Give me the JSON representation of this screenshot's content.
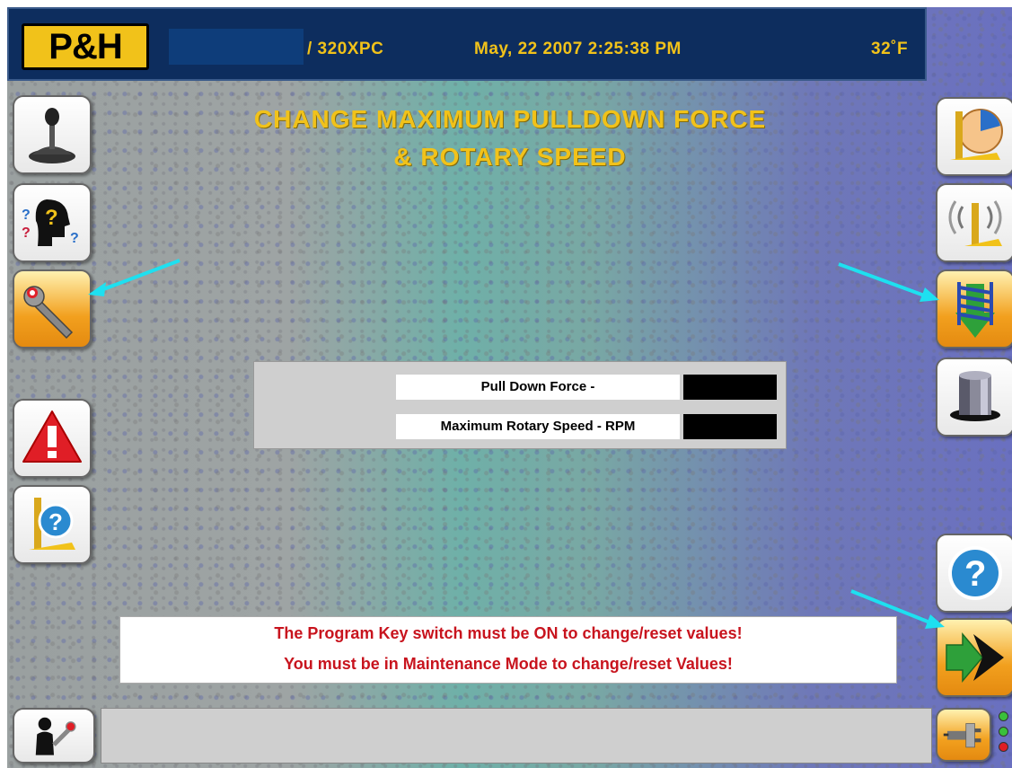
{
  "header": {
    "logo": "P&H",
    "model": "/ 320XPC",
    "datetime": "May, 22 2007 2:25:38 PM",
    "temperature": "32˚F"
  },
  "title": {
    "line1": "CHANGE MAXIMUM PULLDOWN FORCE",
    "line2": "& ROTARY SPEED"
  },
  "form": {
    "fields": [
      {
        "label": "Pull Down Force -",
        "value": ""
      },
      {
        "label": "Maximum Rotary Speed - RPM",
        "value": ""
      }
    ]
  },
  "messages": {
    "line1": "The Program Key switch must be ON to change/reset values!",
    "line2": "You must be in Maintenance Mode to change/reset Values!"
  },
  "status_bar": {
    "text": ""
  },
  "left_buttons": [
    "joystick-icon",
    "help-head-icon",
    "wrench-icon",
    "warning-icon",
    "mast-help-icon"
  ],
  "right_buttons": [
    "mast-clock-icon",
    "mast-signal-icon",
    "pulldown-spring-icon",
    "rotary-drum-icon",
    "help-icon",
    "next-arrow-icon",
    "exit-plug-icon"
  ],
  "colors": {
    "header_bg": "#0d2d5e",
    "accent_yellow": "#f1c21a",
    "warning_red": "#c8141e",
    "pointer_cyan": "#1ee0f0",
    "active_orange": "#f2a01e"
  },
  "active_buttons": [
    "wrench-icon",
    "pulldown-spring-icon",
    "next-arrow-icon"
  ]
}
